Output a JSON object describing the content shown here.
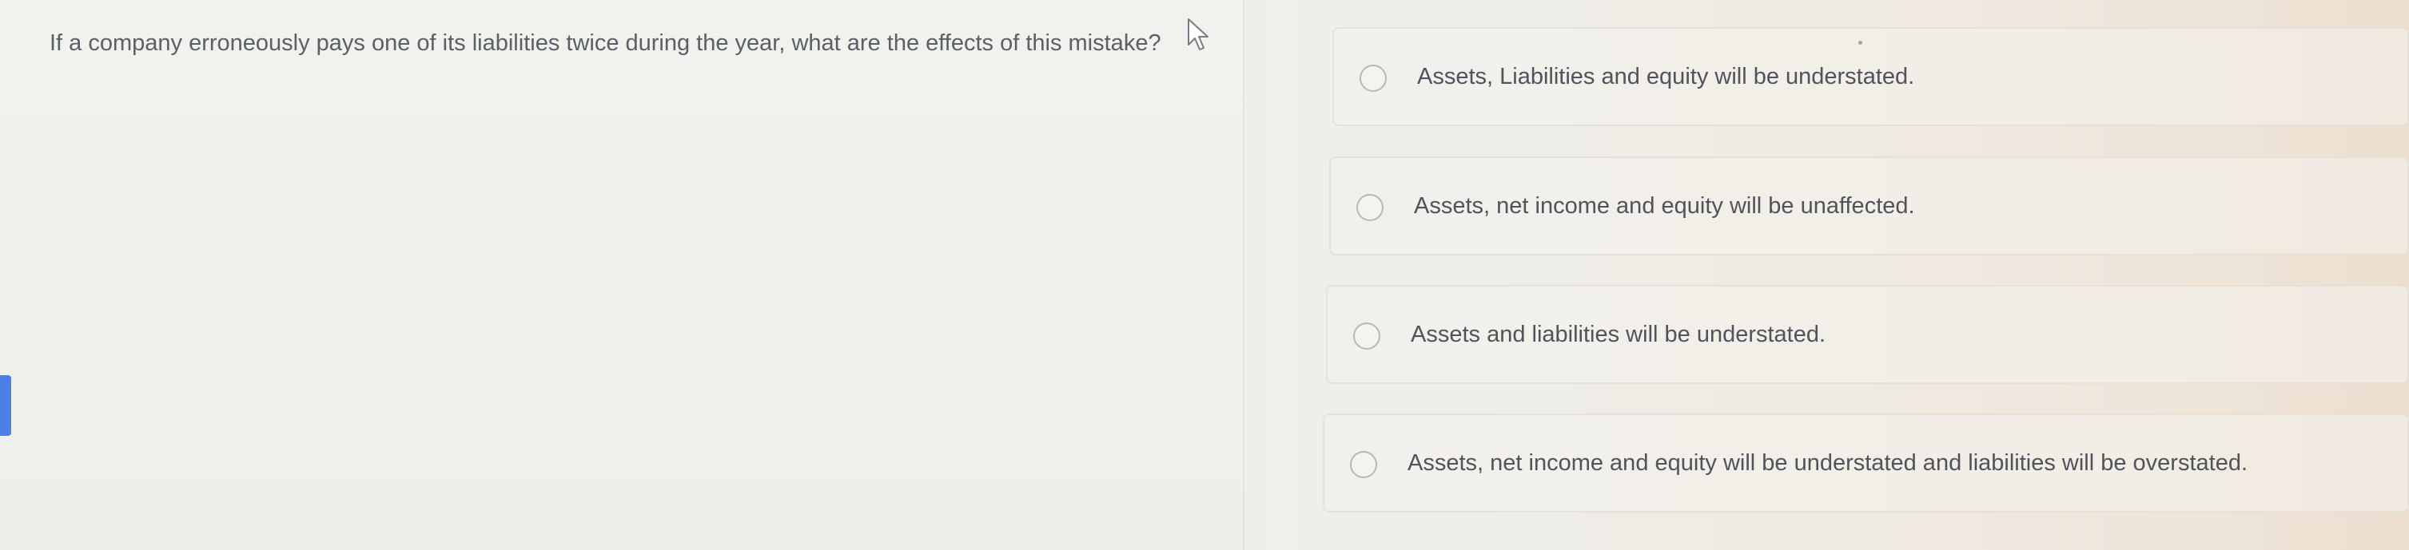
{
  "question": {
    "text": "If a company erroneously pays one of its liabilities twice during the year, what are the effects of this mistake?"
  },
  "options": [
    {
      "label": "Assets, Liabilities and equity will be understated.",
      "selected": false
    },
    {
      "label": "Assets, net income and equity will be unaffected.",
      "selected": false
    },
    {
      "label": "Assets and liabilities will be understated.",
      "selected": false
    },
    {
      "label": "Assets, net income and equity will be understated and liabilities will be overstated.",
      "selected": false
    }
  ],
  "colors": {
    "accent_tab": "#4f7fe6",
    "radio_border": "#b7b8b8",
    "text": "#4f535b"
  },
  "icons": {
    "cursor": "mouse-pointer-icon",
    "radio": "radio-circle-icon"
  }
}
